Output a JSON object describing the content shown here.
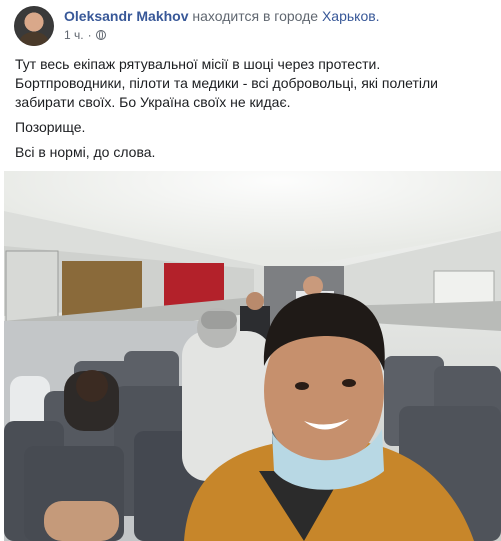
{
  "post": {
    "author": "Oleksandr Makhov",
    "action": "находится в городе",
    "place": "Харьков.",
    "time": "1 ч.",
    "dot": "·",
    "privacy_icon": "globe-icon",
    "paragraphs": [
      "Тут весь екіпаж рятувальної місії в шоці через протести. Бортпроводники, пілоти та медики - всі добровольці, які полетіли забирати своїх. Бо Україна своїх не кидає.",
      "Позорище.",
      "Всі в нормі, до слова."
    ]
  },
  "colors": {
    "link": "#385898",
    "secondary": "#606770",
    "text": "#1c1e21"
  }
}
